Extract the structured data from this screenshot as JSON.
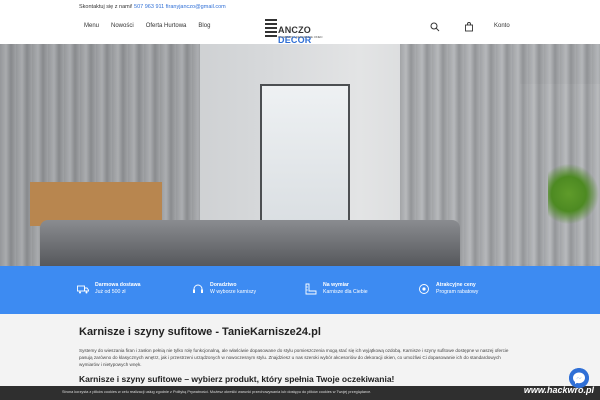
{
  "topbar": {
    "contact_label": "Skontaktuj się z nami!",
    "phone": "507 963 911",
    "email": "firanyjanczo@gmail.com"
  },
  "nav": {
    "items": [
      "Menu",
      "Nowości",
      "Oferta Hurtowa",
      "Blog"
    ],
    "account": "Konto"
  },
  "logo": {
    "part1": "ANCZO",
    "part2": "DECOR",
    "tagline": "WYSPRZĘT I DEKORACJE OKIEN"
  },
  "features": [
    {
      "title": "Darmowa dostawa",
      "sub": "Już od 500 zł",
      "icon": "truck-icon"
    },
    {
      "title": "Doradztwo",
      "sub": "W wyborze karniszy",
      "icon": "headset-icon"
    },
    {
      "title": "Na wymiar",
      "sub": "Karnisze dla Ciebie",
      "icon": "ruler-icon"
    },
    {
      "title": "Atrakcyjne ceny",
      "sub": "Program rabatowy",
      "icon": "badge-icon"
    }
  ],
  "content": {
    "title": "Karnisze i szyny sufitowe - TanieKarnisze24.pl",
    "body": "Systemy do wieszania firan i zasłon pełnią nie tylko rolę funkcjonalną, ale właściwie dopasowane do stylu pomieszczenia mogą stać się ich wyjątkową ozdobą. Karnisze i szyny sufitowe dostępne w naszej ofercie pasują zarówno do klasycznych wnętrz, jak i przestrzeni urządzonych w nowoczesnym stylu. Znajdziesz u nas szeroki wybór akcesoriów do dekoracji okien, co umożliwi Ci dopasowanie ich do standardowych wymiarów i nietypowych wnęk.",
    "subtitle": "Karnisze i szyny sufitowe – wybierz produkt, który spełnia Twoje oczekiwania!"
  },
  "cookie": {
    "text": "Strona korzysta z plików cookies w celu realizacji usług zgodnie z Polityką Prywatności. Możesz określić warunki przechowywania lub dostępu do plików cookies w Twojej przeglądarce."
  },
  "watermark": "www.hackwro.pl"
}
